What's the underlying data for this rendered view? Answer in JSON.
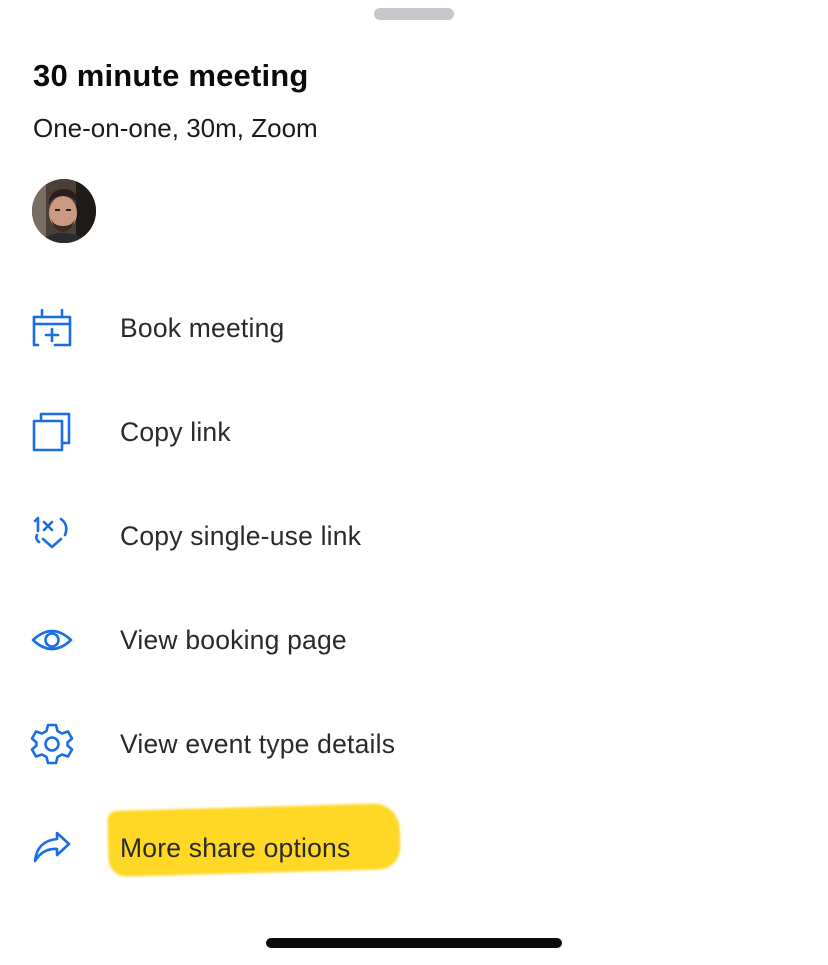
{
  "sheet": {
    "title": "30 minute meeting",
    "subtitle": "One-on-one, 30m, Zoom"
  },
  "colors": {
    "accent": "#1a6fe0",
    "highlight": "#ffd51a"
  },
  "menu": {
    "items": [
      {
        "icon": "calendar-plus-icon",
        "label": "Book meeting"
      },
      {
        "icon": "copy-icon",
        "label": "Copy link"
      },
      {
        "icon": "single-use-link-icon",
        "label": "Copy single-use link"
      },
      {
        "icon": "eye-icon",
        "label": "View booking page"
      },
      {
        "icon": "gear-icon",
        "label": "View event type details"
      },
      {
        "icon": "share-arrow-icon",
        "label": "More share options"
      }
    ]
  }
}
